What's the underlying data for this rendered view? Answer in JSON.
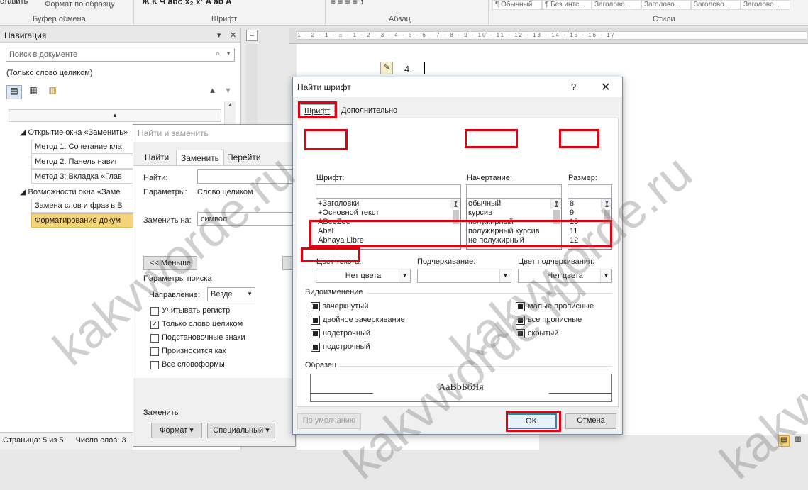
{
  "ribbon": {
    "clipboard_label": "Буфер обмена",
    "paste_partial": "ставить",
    "format_painter": "Формат по образцу",
    "font_label": "Шрифт",
    "paragraph_label": "Абзац",
    "styles_label": "Стили",
    "style_items": [
      "¶ Обычный",
      "¶ Без инте...",
      "Заголово...",
      "Заголово...",
      "Заголово...",
      "Заголово..."
    ]
  },
  "nav": {
    "title": "Навигация",
    "pin": "▾",
    "close": "✕",
    "search_placeholder": "Поиск в документе",
    "search_icon": "🔍",
    "filter_text": "(Только слово целиком)",
    "up_arrow": "▲",
    "down_arrow": "▼",
    "items": [
      {
        "label": "Открытие окна «Заменить»",
        "kind": "head"
      },
      {
        "label": "Метод 1: Сочетание кла",
        "kind": "item"
      },
      {
        "label": "Метод 2: Панель навиг",
        "kind": "item"
      },
      {
        "label": "Метод 3: Вкладка «Глав",
        "kind": "item"
      },
      {
        "label": "Возможности окна «Заме",
        "kind": "head"
      },
      {
        "label": "Замена слов и фраз в В",
        "kind": "item"
      },
      {
        "label": "Форматирование докум",
        "kind": "selected"
      }
    ]
  },
  "document": {
    "list_marker": "4."
  },
  "find_replace": {
    "title": "Найти и заменить",
    "tabs": [
      "Найти",
      "Заменить",
      "Перейти"
    ],
    "find_label": "Найти:",
    "params_label": "Параметры:",
    "params_value": "Слово целиком",
    "replace_label": "Заменить на:",
    "replace_value": "символ",
    "less_button": "<< Меньше",
    "search_params_title": "Параметры поиска",
    "direction_label": "Направление:",
    "direction_value": "Везде",
    "options": [
      {
        "label": "Учитывать регистр",
        "checked": false
      },
      {
        "label": "Только слово целиком",
        "checked": true
      },
      {
        "label": "Подстановочные знаки",
        "checked": false
      },
      {
        "label": "Произносится как",
        "checked": false
      },
      {
        "label": "Все словоформы",
        "checked": false
      }
    ],
    "replace_section": "Заменить",
    "format_button": "Формат ▾",
    "special_button": "Специальный ▾"
  },
  "status": {
    "page": "Страница: 5 из 5",
    "words": "Число слов: 3"
  },
  "font_dialog": {
    "title": "Найти шрифт",
    "help": "?",
    "close": "✕",
    "tabs": [
      "Шрифт",
      "Дополнительно"
    ],
    "font_label": "Шрифт:",
    "style_label": "Начертание:",
    "size_label": "Размер:",
    "fonts": [
      "+Заголовки",
      "+Основной текст",
      "ABeeZee",
      "Abel",
      "Abhaya Libre"
    ],
    "styles": [
      "обычный",
      "курсив",
      "полужирный",
      "полужирный курсив",
      "не полужирный"
    ],
    "sizes": [
      "8",
      "9",
      "10",
      "11",
      "12"
    ],
    "text_color_label": "Цвет текста:",
    "text_color_value": "Нет цвета",
    "underline_label": "Подчеркивание:",
    "underline_value": "",
    "underline_color_label": "Цвет подчеркивания:",
    "underline_color_value": "Нет цвета",
    "effects_title": "Видоизменение",
    "effects_left": [
      "зачеркнутый",
      "двойное зачеркивание",
      "надстрочный",
      "подстрочный"
    ],
    "effects_right": [
      "малые прописные",
      "все прописные",
      "скрытый"
    ],
    "sample_title": "Образец",
    "sample_text": "АаBbБбЯя",
    "default_button": "По умолчанию",
    "ok_button": "OK",
    "cancel_button": "Отмена",
    "highlight_color": "#e3000f"
  },
  "watermark": "kakvworde.ru"
}
